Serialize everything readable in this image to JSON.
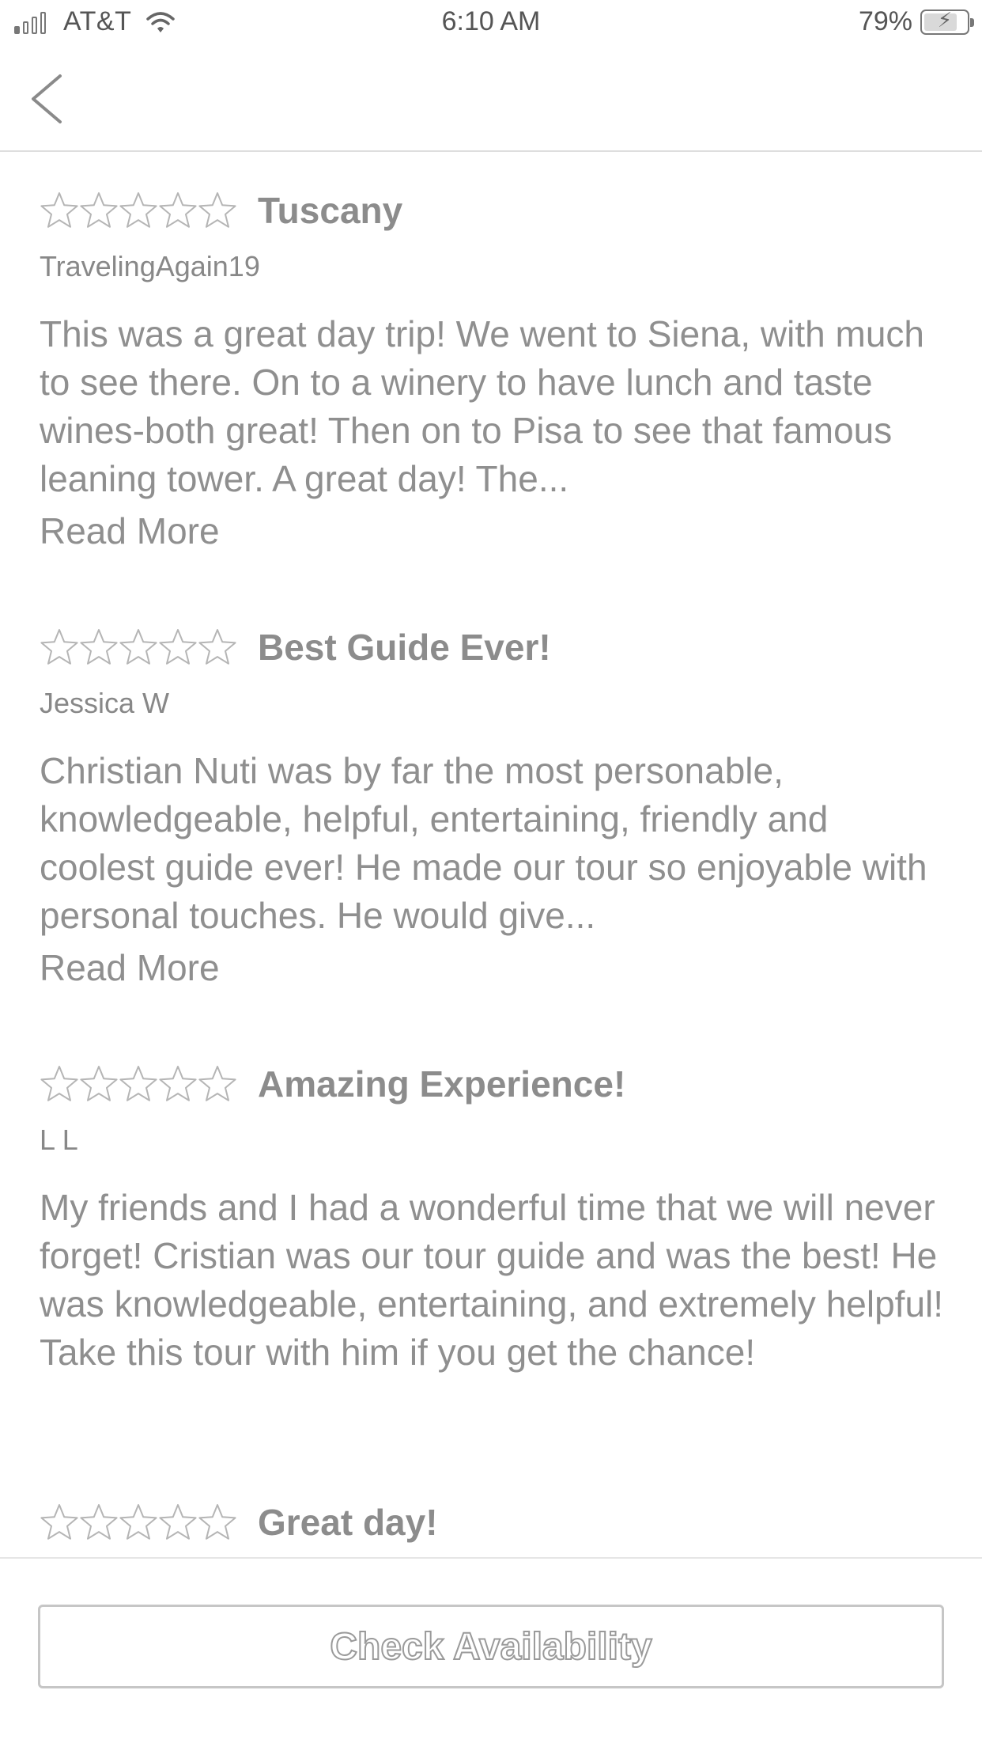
{
  "status_bar": {
    "carrier": "AT&T",
    "time": "6:10 AM",
    "battery_percent": "79%",
    "battery_level": 0.79,
    "signal_bars_active": 1,
    "signal_bars_total": 4,
    "wifi_icon": "wifi-icon",
    "battery_icon": "battery-charging-icon"
  },
  "nav": {
    "back_icon": "chevron-left-icon"
  },
  "reviews": [
    {
      "rating": 0,
      "rating_max": 5,
      "title": "Tuscany",
      "author": "TravelingAgain19",
      "body": "This was a great day trip! We went to Siena, with much to see there. On to a winery to have lunch and taste wines-both great! Then on to Pisa to see that famous leaning tower. A great day! The...",
      "read_more": "Read More"
    },
    {
      "rating": 0,
      "rating_max": 5,
      "title": "Best Guide Ever!",
      "author": "Jessica W",
      "body": "Christian Nuti was by far the most personable, knowledgeable, helpful, entertaining, friendly and coolest guide ever! He made our tour so enjoyable with personal touches. He would give...",
      "read_more": "Read More"
    },
    {
      "rating": 0,
      "rating_max": 5,
      "title": "Amazing Experience!",
      "author": "L L",
      "body": "My friends and I had a wonderful time that we will never forget! Cristian was our tour guide and was the best! He was knowledgeable, entertaining, and extremely helpful! Take this tour with him if you get the chance!",
      "read_more": ""
    },
    {
      "rating": 0,
      "rating_max": 5,
      "title": "Great day!",
      "author": "",
      "body": "",
      "read_more": ""
    }
  ],
  "footer": {
    "check_availability_label": "Check Availability"
  },
  "colors": {
    "text": "#8f8f8f",
    "divider": "#dedede",
    "button_border": "#c6c6c6",
    "star_outline": "#b5b5b5"
  }
}
